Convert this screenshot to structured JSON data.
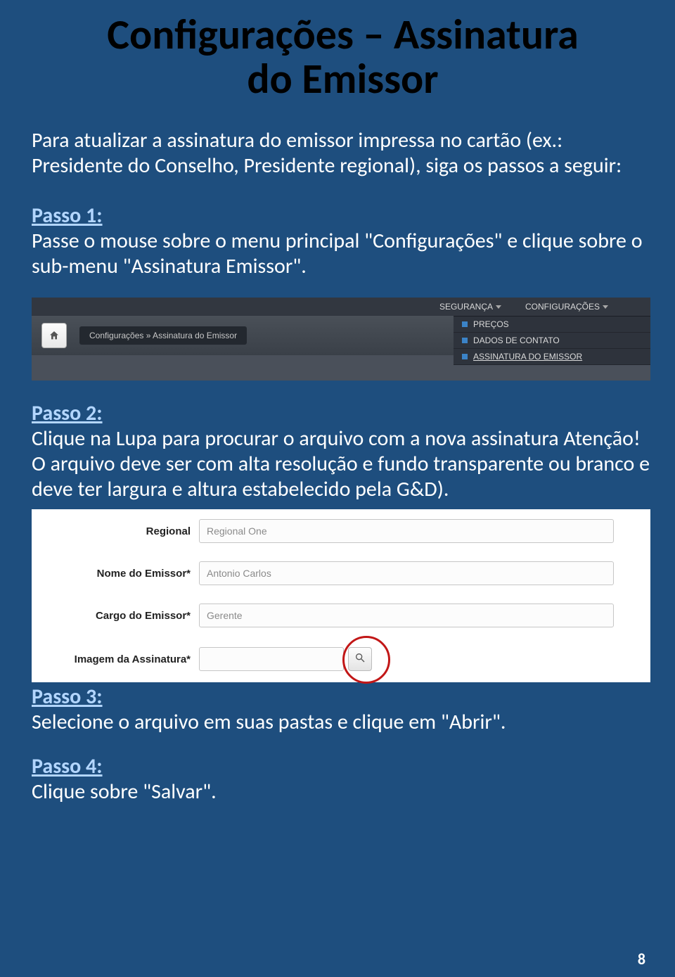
{
  "title_l1": "Configurações – Assinatura",
  "title_l2": "do Emissor",
  "intro": "Para atualizar a assinatura do emissor impressa no cartão (ex.: Presidente do Conselho, Presidente regional), siga os passos a seguir:",
  "passo1": {
    "label": "Passo 1:",
    "text": "Passe o mouse sobre o menu principal \"Configurações\" e clique sobre o sub-menu \"Assinatura Emissor\"."
  },
  "nav": {
    "top_items": [
      "SEGURANÇA",
      "CONFIGURAÇÕES"
    ],
    "breadcrumb": "Configurações » Assinatura do Emissor",
    "dropdown": [
      "PREÇOS",
      "DADOS DE CONTATO",
      "ASSINATURA DO EMISSOR"
    ]
  },
  "passo2": {
    "label": "Passo 2:",
    "text": "Clique na Lupa para procurar o arquivo com a nova assinatura Atenção! O arquivo deve ser com alta resolução e fundo transparente ou branco e deve ter largura e altura estabelecido pela G&D)."
  },
  "form": {
    "rows": [
      {
        "label": "Regional",
        "value": "Regional One"
      },
      {
        "label": "Nome do Emissor*",
        "value": "Antonio Carlos"
      },
      {
        "label": "Cargo do Emissor*",
        "value": "Gerente"
      },
      {
        "label": "Imagem da Assinatura*",
        "value": ""
      }
    ]
  },
  "passo3": {
    "label": "Passo 3:",
    "text": "Selecione o arquivo em suas pastas  e clique em \"Abrir\"."
  },
  "passo4": {
    "label": "Passo 4:",
    "text": "Clique sobre \"Salvar\"."
  },
  "page_number": "8"
}
